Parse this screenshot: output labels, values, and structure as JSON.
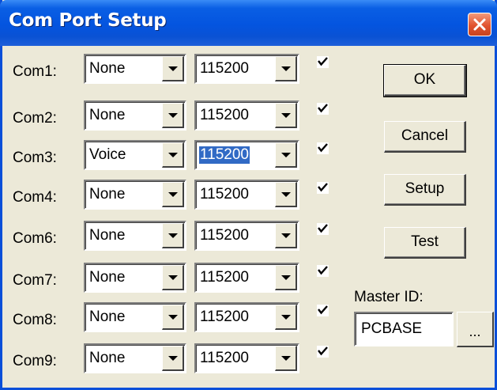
{
  "window": {
    "title": "Com Port Setup",
    "close_icon": "close-icon"
  },
  "ports": [
    {
      "label": "Com1:",
      "device": "None",
      "baud": "115200",
      "enabled": true
    },
    {
      "label": "Com2:",
      "device": "None",
      "baud": "115200",
      "enabled": true
    },
    {
      "label": "Com3:",
      "device": "Voice",
      "baud": "115200",
      "enabled": true,
      "baud_selected": true
    },
    {
      "label": "Com4:",
      "device": "None",
      "baud": "115200",
      "enabled": true
    },
    {
      "label": "Com6:",
      "device": "None",
      "baud": "115200",
      "enabled": true
    },
    {
      "label": "Com7:",
      "device": "None",
      "baud": "115200",
      "enabled": true
    },
    {
      "label": "Com8:",
      "device": "None",
      "baud": "115200",
      "enabled": true
    },
    {
      "label": "Com9:",
      "device": "None",
      "baud": "115200",
      "enabled": true
    }
  ],
  "buttons": {
    "ok": "OK",
    "cancel": "Cancel",
    "setup": "Setup",
    "test": "Test"
  },
  "master": {
    "label": "Master ID:",
    "value": "PCBASE",
    "browse": "..."
  },
  "colors": {
    "title_bar": "#0454df",
    "dialog_bg": "#ece9d8",
    "selection": "#316ac5",
    "close": "#e1532f"
  }
}
